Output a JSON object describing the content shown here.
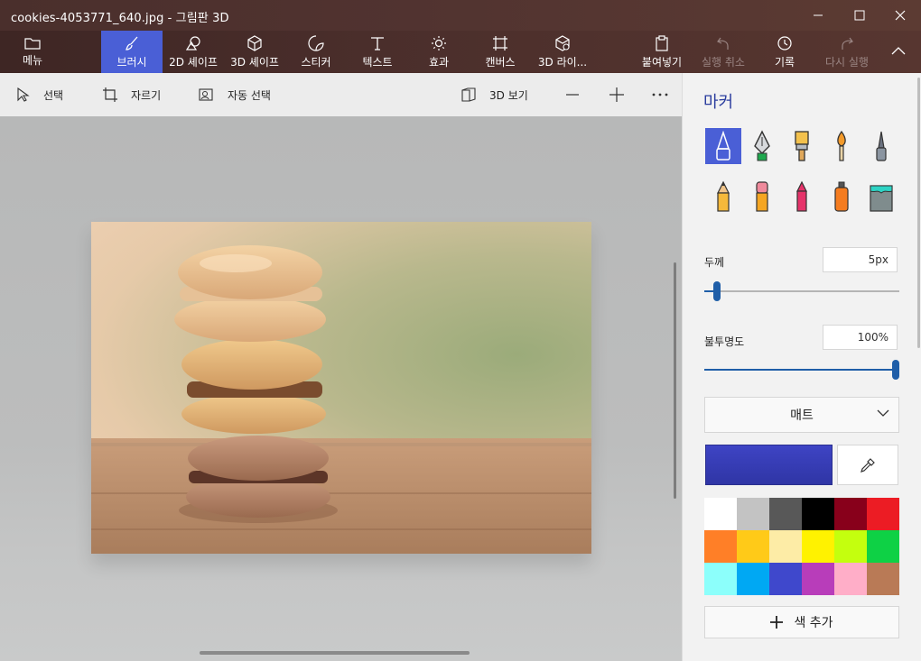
{
  "window": {
    "title": "cookies-4053771_640.jpg - 그림판 3D",
    "controls": {
      "minimize_icon": "minimize-icon",
      "maximize_icon": "maximize-icon",
      "close_icon": "close-icon"
    }
  },
  "ribbon": {
    "menu": "메뉴",
    "tools": [
      {
        "label": "브러시",
        "icon": "brush-icon",
        "active": true
      },
      {
        "label": "2D 셰이프",
        "icon": "shapes-2d-icon"
      },
      {
        "label": "3D 셰이프",
        "icon": "cube-icon"
      },
      {
        "label": "스티커",
        "icon": "sticker-icon"
      },
      {
        "label": "텍스트",
        "icon": "text-icon"
      },
      {
        "label": "효과",
        "icon": "sun-icon"
      },
      {
        "label": "캔버스",
        "icon": "canvas-icon"
      },
      {
        "label": "3D 라이...",
        "icon": "library-3d-icon"
      }
    ],
    "paste": "붙여넣기",
    "undo": "실행 취소",
    "history": "기록",
    "redo": "다시 실행"
  },
  "subtoolbar": {
    "select": "선택",
    "crop": "자르기",
    "magic_select": "자동 선택",
    "view3d": "3D 보기",
    "zoom_out_icon": "minus-icon",
    "zoom_in_icon": "plus-icon",
    "more_icon": "more-icon"
  },
  "panel": {
    "title": "마커",
    "brushes": [
      "marker-icon",
      "calligraphy-pen-icon",
      "oil-brush-icon",
      "watercolor-icon",
      "pixel-pen-icon",
      "pencil-icon",
      "eraser-icon",
      "crayon-icon",
      "spray-can-icon",
      "fill-bucket-icon"
    ],
    "thickness": {
      "label": "두께",
      "value": "5px",
      "fraction": 0.05
    },
    "opacity": {
      "label": "불투명도",
      "value": "100%",
      "fraction": 1.0
    },
    "finish": "매트",
    "current_color": "#3e44c4",
    "palette": [
      "#ffffff",
      "#c3c3c3",
      "#585858",
      "#000000",
      "#88001b",
      "#ec1c24",
      "#ff7f27",
      "#ffca18",
      "#fdeca6",
      "#fff200",
      "#c4ff0e",
      "#0ed145",
      "#8cfffb",
      "#00a8f3",
      "#3f48cc",
      "#b83dba",
      "#ffaec8",
      "#b97a56"
    ],
    "add_color": "색 추가"
  },
  "canvas": {
    "image_name": "macaron-stack-photo"
  }
}
